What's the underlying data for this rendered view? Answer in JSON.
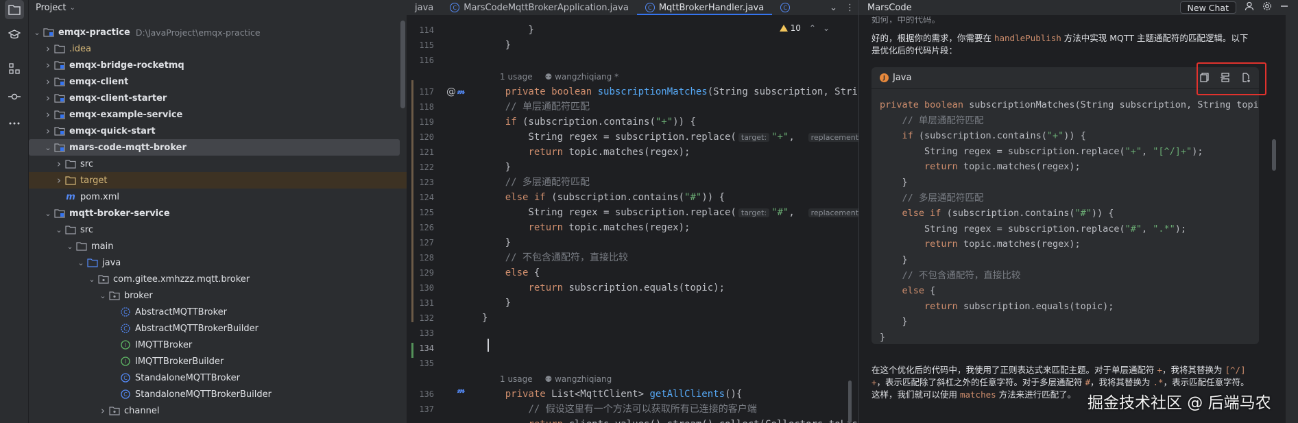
{
  "toolstrip": {
    "items": [
      "folder-icon",
      "learn-icon",
      "structure-icon",
      "commit-icon",
      "more-icon"
    ]
  },
  "project": {
    "title": "Project",
    "tree": [
      {
        "label": "emqx-practice",
        "path": "D:\\JavaProject\\emqx-practice",
        "depth": 0,
        "arrow": "open",
        "icon": "module",
        "bold": true
      },
      {
        "label": ".idea",
        "depth": 1,
        "arrow": "closed",
        "icon": "folder",
        "orange": true
      },
      {
        "label": "emqx-bridge-rocketmq",
        "depth": 1,
        "arrow": "closed",
        "icon": "module",
        "bold": true
      },
      {
        "label": "emqx-client",
        "depth": 1,
        "arrow": "closed",
        "icon": "module",
        "bold": true
      },
      {
        "label": "emqx-client-starter",
        "depth": 1,
        "arrow": "closed",
        "icon": "module",
        "bold": true
      },
      {
        "label": "emqx-example-service",
        "depth": 1,
        "arrow": "closed",
        "icon": "module",
        "bold": true
      },
      {
        "label": "emqx-quick-start",
        "depth": 1,
        "arrow": "closed",
        "icon": "module",
        "bold": true
      },
      {
        "label": "mars-code-mqtt-broker",
        "depth": 1,
        "arrow": "open",
        "icon": "module",
        "bold": true,
        "selected": true
      },
      {
        "label": "src",
        "depth": 2,
        "arrow": "closed",
        "icon": "folder"
      },
      {
        "label": "target",
        "depth": 2,
        "arrow": "closed",
        "icon": "folder-orange",
        "orange": true,
        "excluded": true
      },
      {
        "label": "pom.xml",
        "depth": 2,
        "arrow": "none",
        "icon": "maven"
      },
      {
        "label": "mqtt-broker-service",
        "depth": 1,
        "arrow": "open",
        "icon": "module",
        "bold": true
      },
      {
        "label": "src",
        "depth": 2,
        "arrow": "open",
        "icon": "folder"
      },
      {
        "label": "main",
        "depth": 3,
        "arrow": "open",
        "icon": "folder"
      },
      {
        "label": "java",
        "depth": 4,
        "arrow": "open",
        "icon": "folder-blue"
      },
      {
        "label": "com.gitee.xmhzzz.mqtt.broker",
        "depth": 5,
        "arrow": "open",
        "icon": "package"
      },
      {
        "label": "broker",
        "depth": 6,
        "arrow": "open",
        "icon": "package"
      },
      {
        "label": "AbstractMQTTBroker",
        "depth": 7,
        "arrow": "none",
        "icon": "abstract-class"
      },
      {
        "label": "AbstractMQTTBrokerBuilder",
        "depth": 7,
        "arrow": "none",
        "icon": "abstract-class"
      },
      {
        "label": "IMQTTBroker",
        "depth": 7,
        "arrow": "none",
        "icon": "interface"
      },
      {
        "label": "IMQTTBrokerBuilder",
        "depth": 7,
        "arrow": "none",
        "icon": "interface"
      },
      {
        "label": "StandaloneMQTTBroker",
        "depth": 7,
        "arrow": "none",
        "icon": "class"
      },
      {
        "label": "StandaloneMQTTBrokerBuilder",
        "depth": 7,
        "arrow": "none",
        "icon": "class"
      },
      {
        "label": "channel",
        "depth": 6,
        "arrow": "closed",
        "icon": "package"
      }
    ]
  },
  "editor": {
    "tabs": [
      {
        "label": "java",
        "icon": false,
        "active": false
      },
      {
        "label": "MarsCodeMqttBrokerApplication.java",
        "icon": true,
        "active": false
      },
      {
        "label": "MqttBrokerHandler.java",
        "icon": true,
        "active": true
      }
    ],
    "warnings": "10",
    "usage_1": "1 usage",
    "author_1": "wangzhiqiang *",
    "usage_2": "1 usage",
    "author_2": "wangzhiqiang",
    "hint_target": "target:",
    "hint_replacement": "replacement:",
    "lines": [
      "114",
      "115",
      "116",
      "117",
      "118",
      "119",
      "120",
      "121",
      "122",
      "123",
      "124",
      "125",
      "126",
      "127",
      "128",
      "129",
      "130",
      "131",
      "132",
      "133",
      "134",
      "135",
      "136",
      "137"
    ],
    "current_line": "134"
  },
  "mars": {
    "title": "MarsCode",
    "new_chat": "New Chat",
    "top_cut": "如何，中的代码。",
    "intro_1": "好的，根据你的需求，你需要在 ",
    "intro_code": "handlePublish",
    "intro_2": " 方法中实现 MQTT 主题通配符的匹配逻辑。以下",
    "intro_3": "是优化后的代码片段：",
    "lang": "Java",
    "code_lines": [
      "private boolean subscriptionMatches(String subscription, String topi",
      "    // 单层通配符匹配",
      "    if (subscription.contains(\"+\")) {",
      "        String regex = subscription.replace(\"+\", \"[^/]+\");",
      "        return topic.matches(regex);",
      "    }",
      "    // 多层通配符匹配",
      "    else if (subscription.contains(\"#\")) {",
      "        String regex = subscription.replace(\"#\", \".*\");",
      "        return topic.matches(regex);",
      "    }",
      "    // 不包含通配符，直接比较",
      "    else {",
      "        return subscription.equals(topic);",
      "    }",
      "}"
    ],
    "outro_1a": "在这个优化后的代码中，我使用了正则表达式来匹配主题。对于单层通配符 ",
    "outro_plus": "+",
    "outro_1b": "，我将其替换为 ",
    "outro_regex1": "[^/]",
    "outro_2a": "+",
    "outro_2b": "，表示匹配除了斜杠之外的任意字符。对于多层通配符 ",
    "outro_hash": "#",
    "outro_2c": "，我将其替换为 ",
    "outro_regex2": ".*",
    "outro_2d": "，表示匹配任意字符。",
    "outro_3a": "这样，我们就可以使用 ",
    "outro_matches": "matches",
    "outro_3b": " 方法来进行匹配了。"
  },
  "watermark": "掘金技术社区 @ 后端马农",
  "colors": {
    "accent": "#3574f0",
    "highlight_box": "#e2322d",
    "keyword": "#cf8e6d",
    "function": "#56a8f5",
    "string": "#6aab73",
    "comment": "#7a7e85"
  }
}
